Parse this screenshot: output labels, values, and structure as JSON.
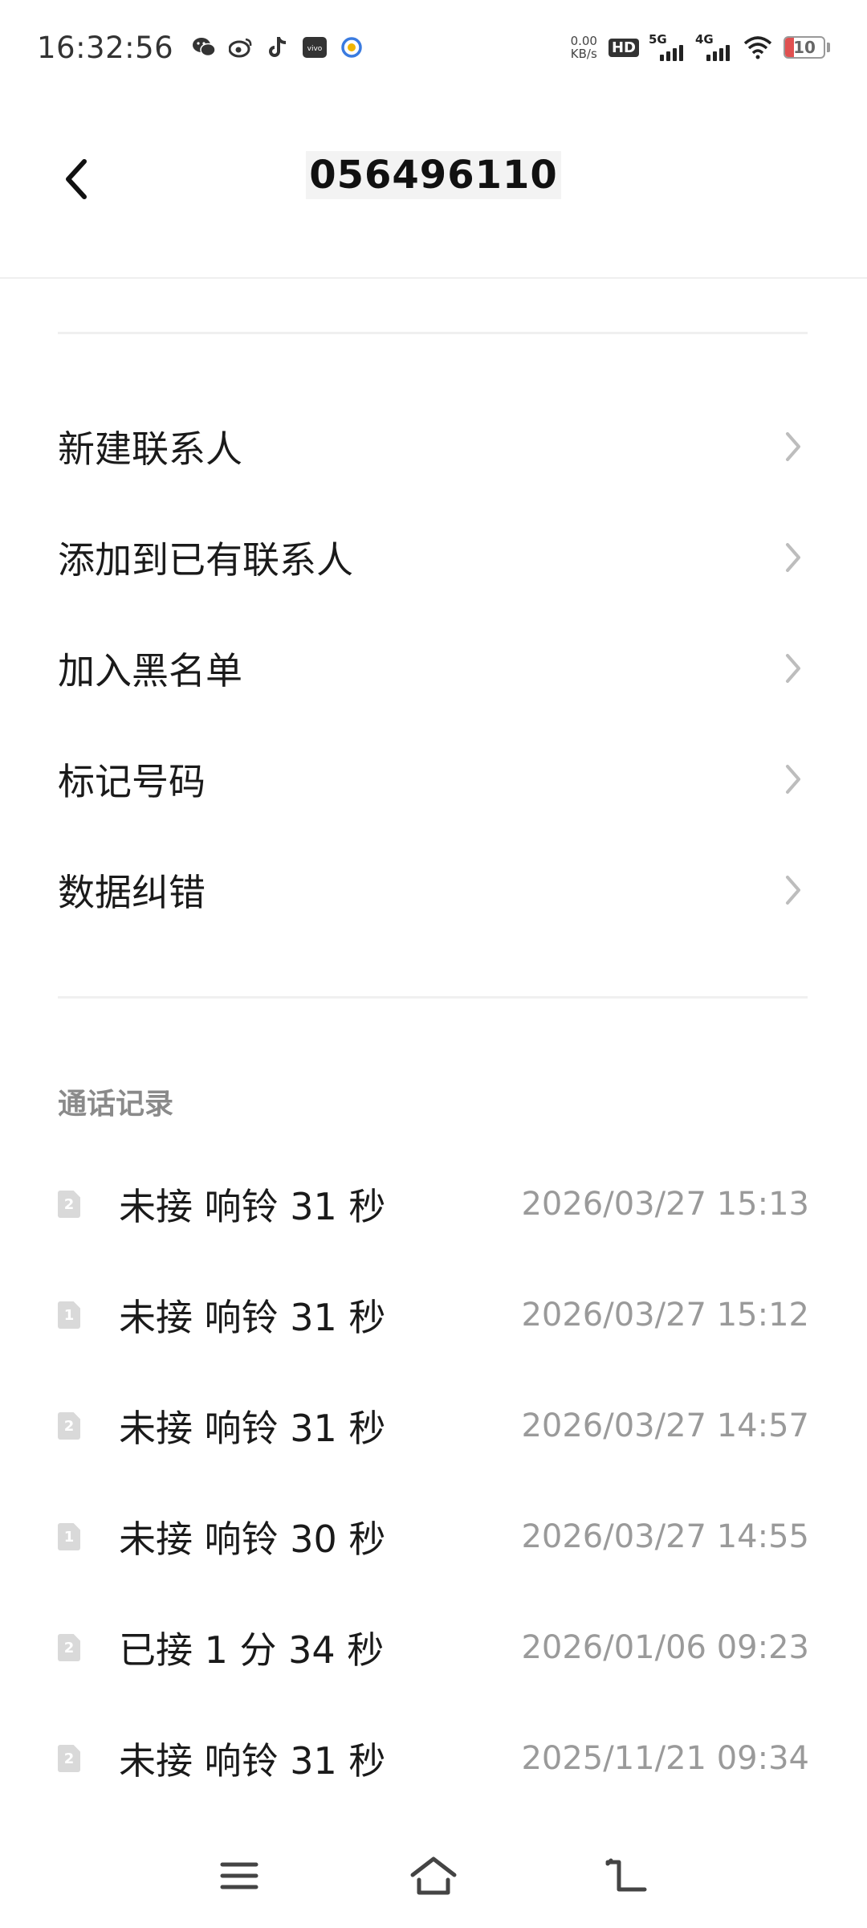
{
  "status_bar": {
    "time": "16:32:56",
    "net_speed_value": "0.00",
    "net_speed_unit": "KB/s",
    "hd_label": "HD",
    "sim1_label": "5G",
    "sim2_label": "4G",
    "battery": "10",
    "notification_icons": [
      "wechat-icon",
      "weibo-icon",
      "tiktok-icon",
      "vivo-icon",
      "browser-icon"
    ]
  },
  "header": {
    "title": "056496110"
  },
  "menu": {
    "items": [
      {
        "label": "新建联系人"
      },
      {
        "label": "添加到已有联系人"
      },
      {
        "label": "加入黑名单"
      },
      {
        "label": "标记号码"
      },
      {
        "label": "数据纠错"
      }
    ]
  },
  "call_log": {
    "title": "通话记录",
    "rows": [
      {
        "sim": "2",
        "desc": "未接 响铃 31 秒",
        "time": "2026/03/27 15:13"
      },
      {
        "sim": "1",
        "desc": "未接 响铃 31 秒",
        "time": "2026/03/27 15:12"
      },
      {
        "sim": "2",
        "desc": "未接 响铃 31 秒",
        "time": "2026/03/27 14:57"
      },
      {
        "sim": "1",
        "desc": "未接 响铃 30 秒",
        "time": "2026/03/27 14:55"
      },
      {
        "sim": "2",
        "desc": "已接 1 分 34 秒",
        "time": "2026/01/06 09:23"
      },
      {
        "sim": "2",
        "desc": "未接 响铃 31 秒",
        "time": "2025/11/21 09:34"
      }
    ]
  },
  "nav": {
    "menu_icon": "menu-icon",
    "home_icon": "home-icon",
    "back_icon": "back-icon"
  },
  "colors": {
    "battery_low": "#e05050",
    "secondary_text": "#9a9a9a",
    "sim_badge": "#d9d9d9"
  }
}
